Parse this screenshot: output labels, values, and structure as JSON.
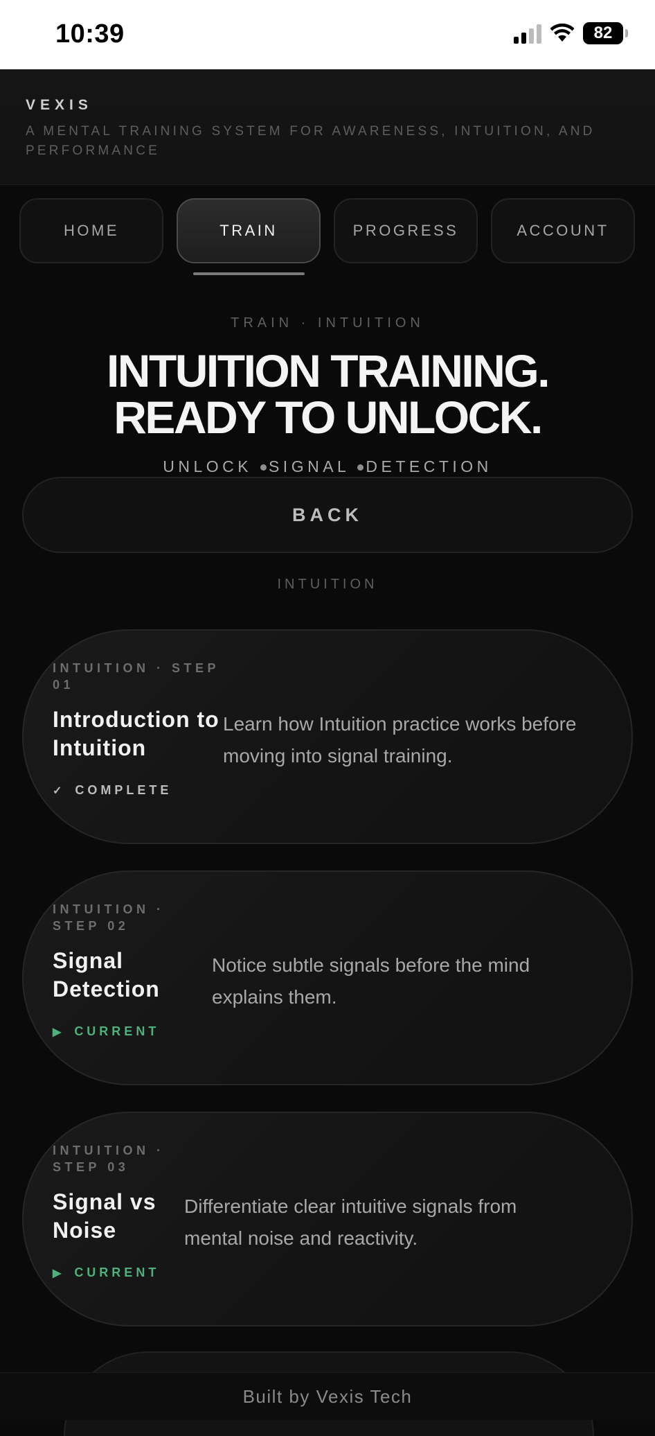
{
  "status_bar": {
    "time": "10:39",
    "battery": "82"
  },
  "header": {
    "brand": "VEXIS",
    "tagline": "A MENTAL TRAINING SYSTEM FOR AWARENESS, INTUITION, AND PERFORMANCE"
  },
  "nav": {
    "tabs": [
      {
        "label": "HOME"
      },
      {
        "label": "TRAIN"
      },
      {
        "label": "PROGRESS"
      },
      {
        "label": "ACCOUNT"
      }
    ],
    "active": "TRAIN"
  },
  "hero": {
    "breadcrumb": "TRAIN · INTUITION",
    "title_line1": "INTUITION TRAINING.",
    "title_line2": "READY TO UNLOCK.",
    "unlock_items": [
      "UNLOCK",
      "SIGNAL",
      "DETECTION"
    ]
  },
  "back_label": "BACK",
  "section_label": "INTUITION",
  "steps": [
    {
      "label": "INTUITION · STEP 01",
      "title": "Introduction to Intuition",
      "description": "Learn how Intuition practice works before moving into signal training.",
      "status": "COMPLETE",
      "status_icon": "check-icon",
      "status_color": "#bdbdbd"
    },
    {
      "label": "INTUITION · STEP 02",
      "title": "Signal Detection",
      "description": "Notice subtle signals before the mind explains them.",
      "status": "CURRENT",
      "status_icon": "play-icon",
      "status_color": "#4fb07c"
    },
    {
      "label": "INTUITION · STEP 03",
      "title": "Signal vs Noise",
      "description": "Differentiate clear intuitive signals from mental noise and reactivity.",
      "status": "CURRENT",
      "status_icon": "play-icon",
      "status_color": "#4fb07c"
    }
  ],
  "footer": "Built by Vexis Tech"
}
